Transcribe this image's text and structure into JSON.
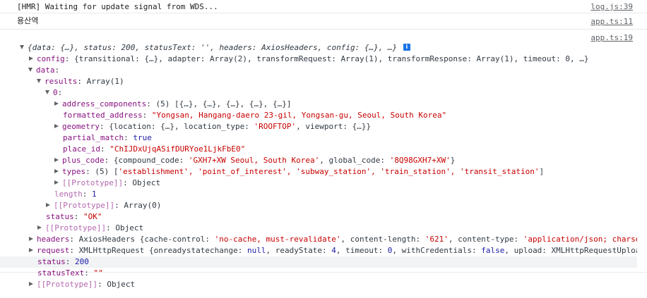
{
  "messages": [
    {
      "text": "[HMR] Waiting for update signal from WDS...",
      "source": "log.js:39"
    },
    {
      "text": "용산역",
      "source": "app.ts:11"
    },
    {
      "source": "app.ts:19"
    }
  ],
  "tree": {
    "root_summary": "{data: {…}, status: 200, statusText: '', headers: AxiosHeaders, config: {…}, …}",
    "info_badge": "i",
    "config_key": "config",
    "config_value": "{transitional: {…}, adapter: Array(2), transformRequest: Array(1), transformResponse: Array(1), timeout: 0, …}",
    "data_key": "data",
    "results_key": "results",
    "results_value": "Array(1)",
    "index_key": "0",
    "address_components_key": "address_components",
    "address_components_value": "(5) [{…}, {…}, {…}, {…}, {…}]",
    "formatted_address_key": "formatted_address",
    "formatted_address_value": "\"Yongsan, Hangang-daero 23-gil, Yongsan-gu, Seoul, South Korea\"",
    "geometry_key": "geometry",
    "geometry_value_a": "{location: {…}, location_type: ",
    "geometry_value_str": "'ROOFTOP'",
    "geometry_value_b": ", viewport: {…}}",
    "partial_match_key": "partial_match",
    "partial_match_value": "true",
    "place_id_key": "place_id",
    "place_id_value": "\"ChIJDxUjqASifDURYoe1LjkFbE0\"",
    "plus_code_key": "plus_code",
    "plus_code_value_a": "{compound_code: ",
    "plus_code_value_str1": "'GXH7+XW Seoul, South Korea'",
    "plus_code_value_b": ", global_code: ",
    "plus_code_value_str2": "'8Q98GXH7+XW'",
    "plus_code_value_c": "}",
    "types_key": "types",
    "types_value_a": "(5) [",
    "types_items": "'establishment', 'point_of_interest', 'subway_station', 'train_station', 'transit_station'",
    "types_value_b": "]",
    "prototype_key": "[[Prototype]]",
    "prototype_object": "Object",
    "length_key": "length",
    "length_value": "1",
    "prototype_array": "Array(0)",
    "status_key": "status",
    "status_ok": "\"OK\"",
    "headers_key": "headers",
    "headers_value_a": "AxiosHeaders {cache-control: ",
    "headers_value_str1": "'no-cache, must-revalidate'",
    "headers_value_b": ", content-length: ",
    "headers_value_str2": "'621'",
    "headers_value_c": ", content-type: ",
    "headers_value_str3": "'application/json; charse",
    "request_key": "request",
    "request_value_a": "XMLHttpRequest {onreadystatechange: ",
    "request_value_null": "null",
    "request_value_b": ", readyState: ",
    "request_value_4": "4",
    "request_value_c": ", timeout: ",
    "request_value_0": "0",
    "request_value_d": ", withCredentials: ",
    "request_value_false": "false",
    "request_value_e": ", upload: XMLHttpRequestUploa",
    "status_code": "200",
    "status_text_key": "statusText",
    "status_text_value": "\"\""
  }
}
